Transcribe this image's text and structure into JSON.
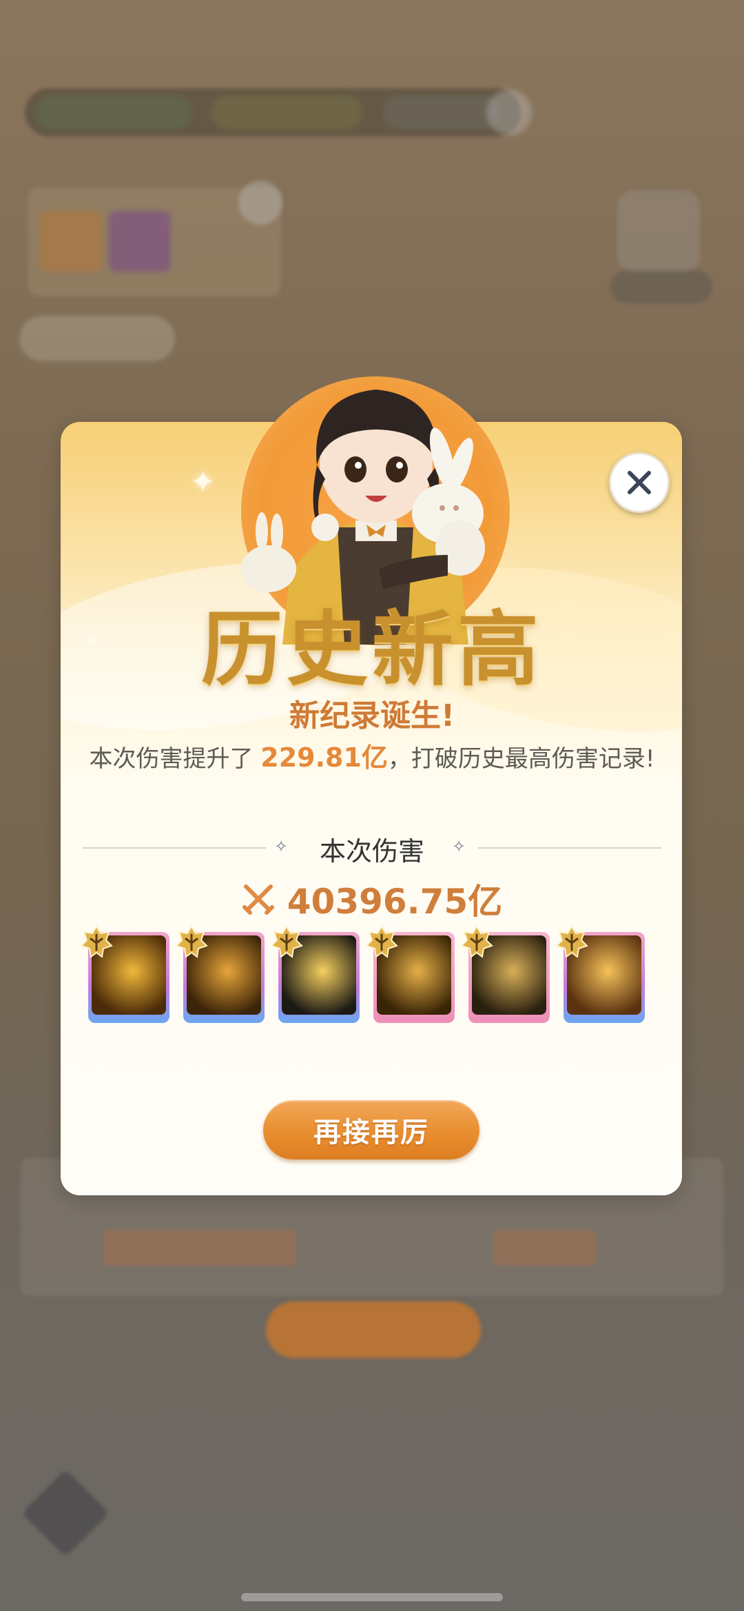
{
  "dialog": {
    "title": "历史新高",
    "subtitle": "新纪录诞生!",
    "desc_prefix": "本次伤害提升了 ",
    "desc_highlight": "229.81亿",
    "desc_suffix": "，打破历史最高伤害记录!",
    "section_label": "本次伤害",
    "damage_value": "40396.75亿",
    "retry_label": "再接再厉",
    "skills": [
      {
        "name": "skill-1",
        "colors": [
          "#4a2a08",
          "#f1b93a"
        ]
      },
      {
        "name": "skill-2",
        "colors": [
          "#3c2408",
          "#e6a53a"
        ]
      },
      {
        "name": "skill-3",
        "colors": [
          "#1c1a14",
          "#f5d060"
        ]
      },
      {
        "name": "skill-4",
        "colors": [
          "#3a2406",
          "#e4b048"
        ]
      },
      {
        "name": "skill-5",
        "colors": [
          "#2a200e",
          "#d8b05a"
        ]
      },
      {
        "name": "skill-6",
        "colors": [
          "#5a3210",
          "#f5c25a"
        ]
      }
    ]
  },
  "colors": {
    "accent": "#e5893a",
    "title": "#c8912e",
    "button": "#e98e2f"
  }
}
